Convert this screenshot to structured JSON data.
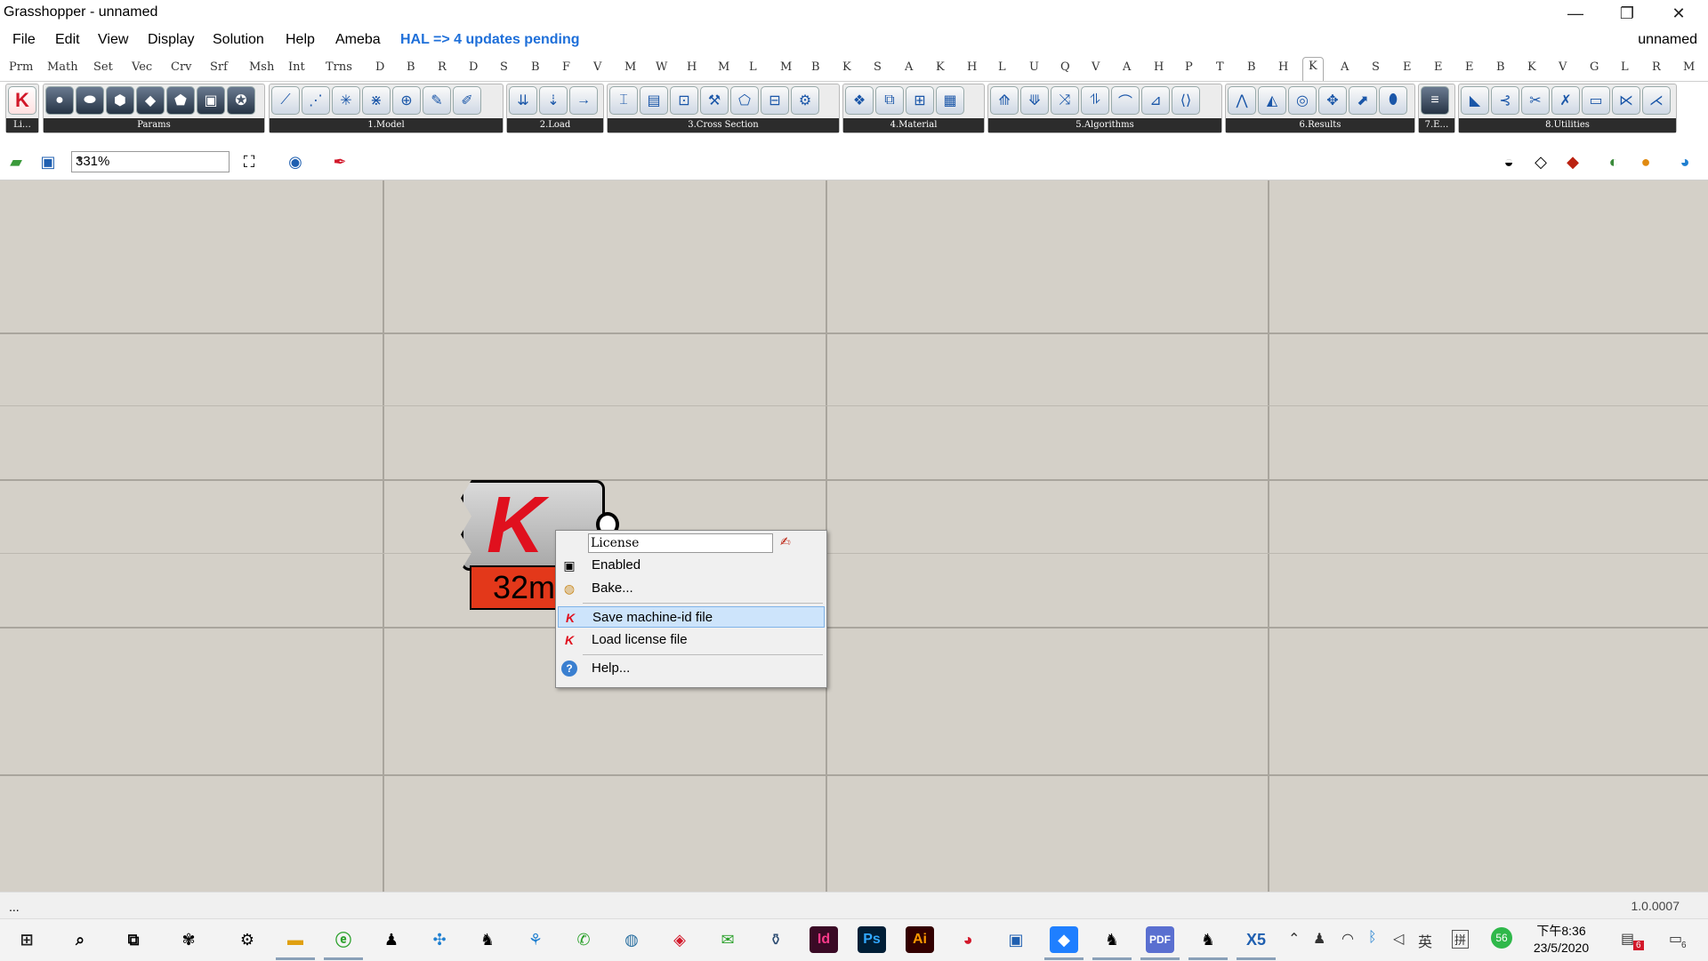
{
  "window": {
    "title": "Grasshopper - unnamed",
    "minimize": "—",
    "restore": "❐",
    "close": "✕"
  },
  "menubar": {
    "items": [
      "File",
      "Edit",
      "View",
      "Display",
      "Solution",
      "Help",
      "Ameba"
    ],
    "hal_notice": "HAL => 4 updates pending",
    "document": "unnamed"
  },
  "tabs": {
    "items": [
      "Prm",
      "Math",
      "Set",
      "Vec",
      "Crv",
      "Srf",
      "Msh",
      "Int",
      "Trns",
      "D",
      "B",
      "R",
      "D",
      "S",
      "B",
      "F",
      "V",
      "M",
      "W",
      "H",
      "M",
      "L",
      "M",
      "B",
      "K",
      "S",
      "A",
      "K",
      "H",
      "L",
      "U",
      "Q",
      "V",
      "A",
      "H",
      "P",
      "T",
      "B",
      "H",
      "K",
      "A",
      "S",
      "E",
      "E",
      "E",
      "B",
      "K",
      "V",
      "G",
      "L",
      "R",
      "M"
    ],
    "active_index": 39
  },
  "ribbon": {
    "groups": [
      {
        "label": "Li…"
      },
      {
        "label": "Params"
      },
      {
        "label": "1.Model"
      },
      {
        "label": "2.Load"
      },
      {
        "label": "3.Cross Section"
      },
      {
        "label": "4.Material"
      },
      {
        "label": "5.Algorithms"
      },
      {
        "label": "6.Results"
      },
      {
        "label": "7.E…"
      },
      {
        "label": "8.Utilities"
      }
    ]
  },
  "canvas_toolbar": {
    "zoom": "331%"
  },
  "component": {
    "value": "32m"
  },
  "context_menu": {
    "name_field": "License",
    "items": [
      {
        "label": "Enabled",
        "icon": "enabled-icon"
      },
      {
        "label": "Bake...",
        "icon": "bake-icon"
      },
      {
        "label": "Save machine-id file",
        "icon": "karamba-icon",
        "highlighted": true
      },
      {
        "label": "Load license file",
        "icon": "karamba-icon"
      },
      {
        "label": "Help...",
        "icon": "help-icon"
      }
    ]
  },
  "statusbar": {
    "left": "...",
    "version": "1.0.0007"
  },
  "taskbar": {
    "tray_ime": "英",
    "tray_pinyin": "拼",
    "tray_badge": "56",
    "notif_badge": "6",
    "action_badge": "6",
    "clock_time": "下午8:36",
    "clock_date": "23/5/2020",
    "apps": {
      "id": "Id",
      "ps": "Ps",
      "ai": "Ai",
      "pdf": "PDF",
      "x5": "X5"
    }
  },
  "colors": {
    "canvas": "#d4d0c8",
    "grid": "#a9a59d",
    "hal": "#1e6fd9",
    "karamba_red": "#e0101e",
    "panel_orange": "#e3381a",
    "highlight": "#cde4fb"
  }
}
